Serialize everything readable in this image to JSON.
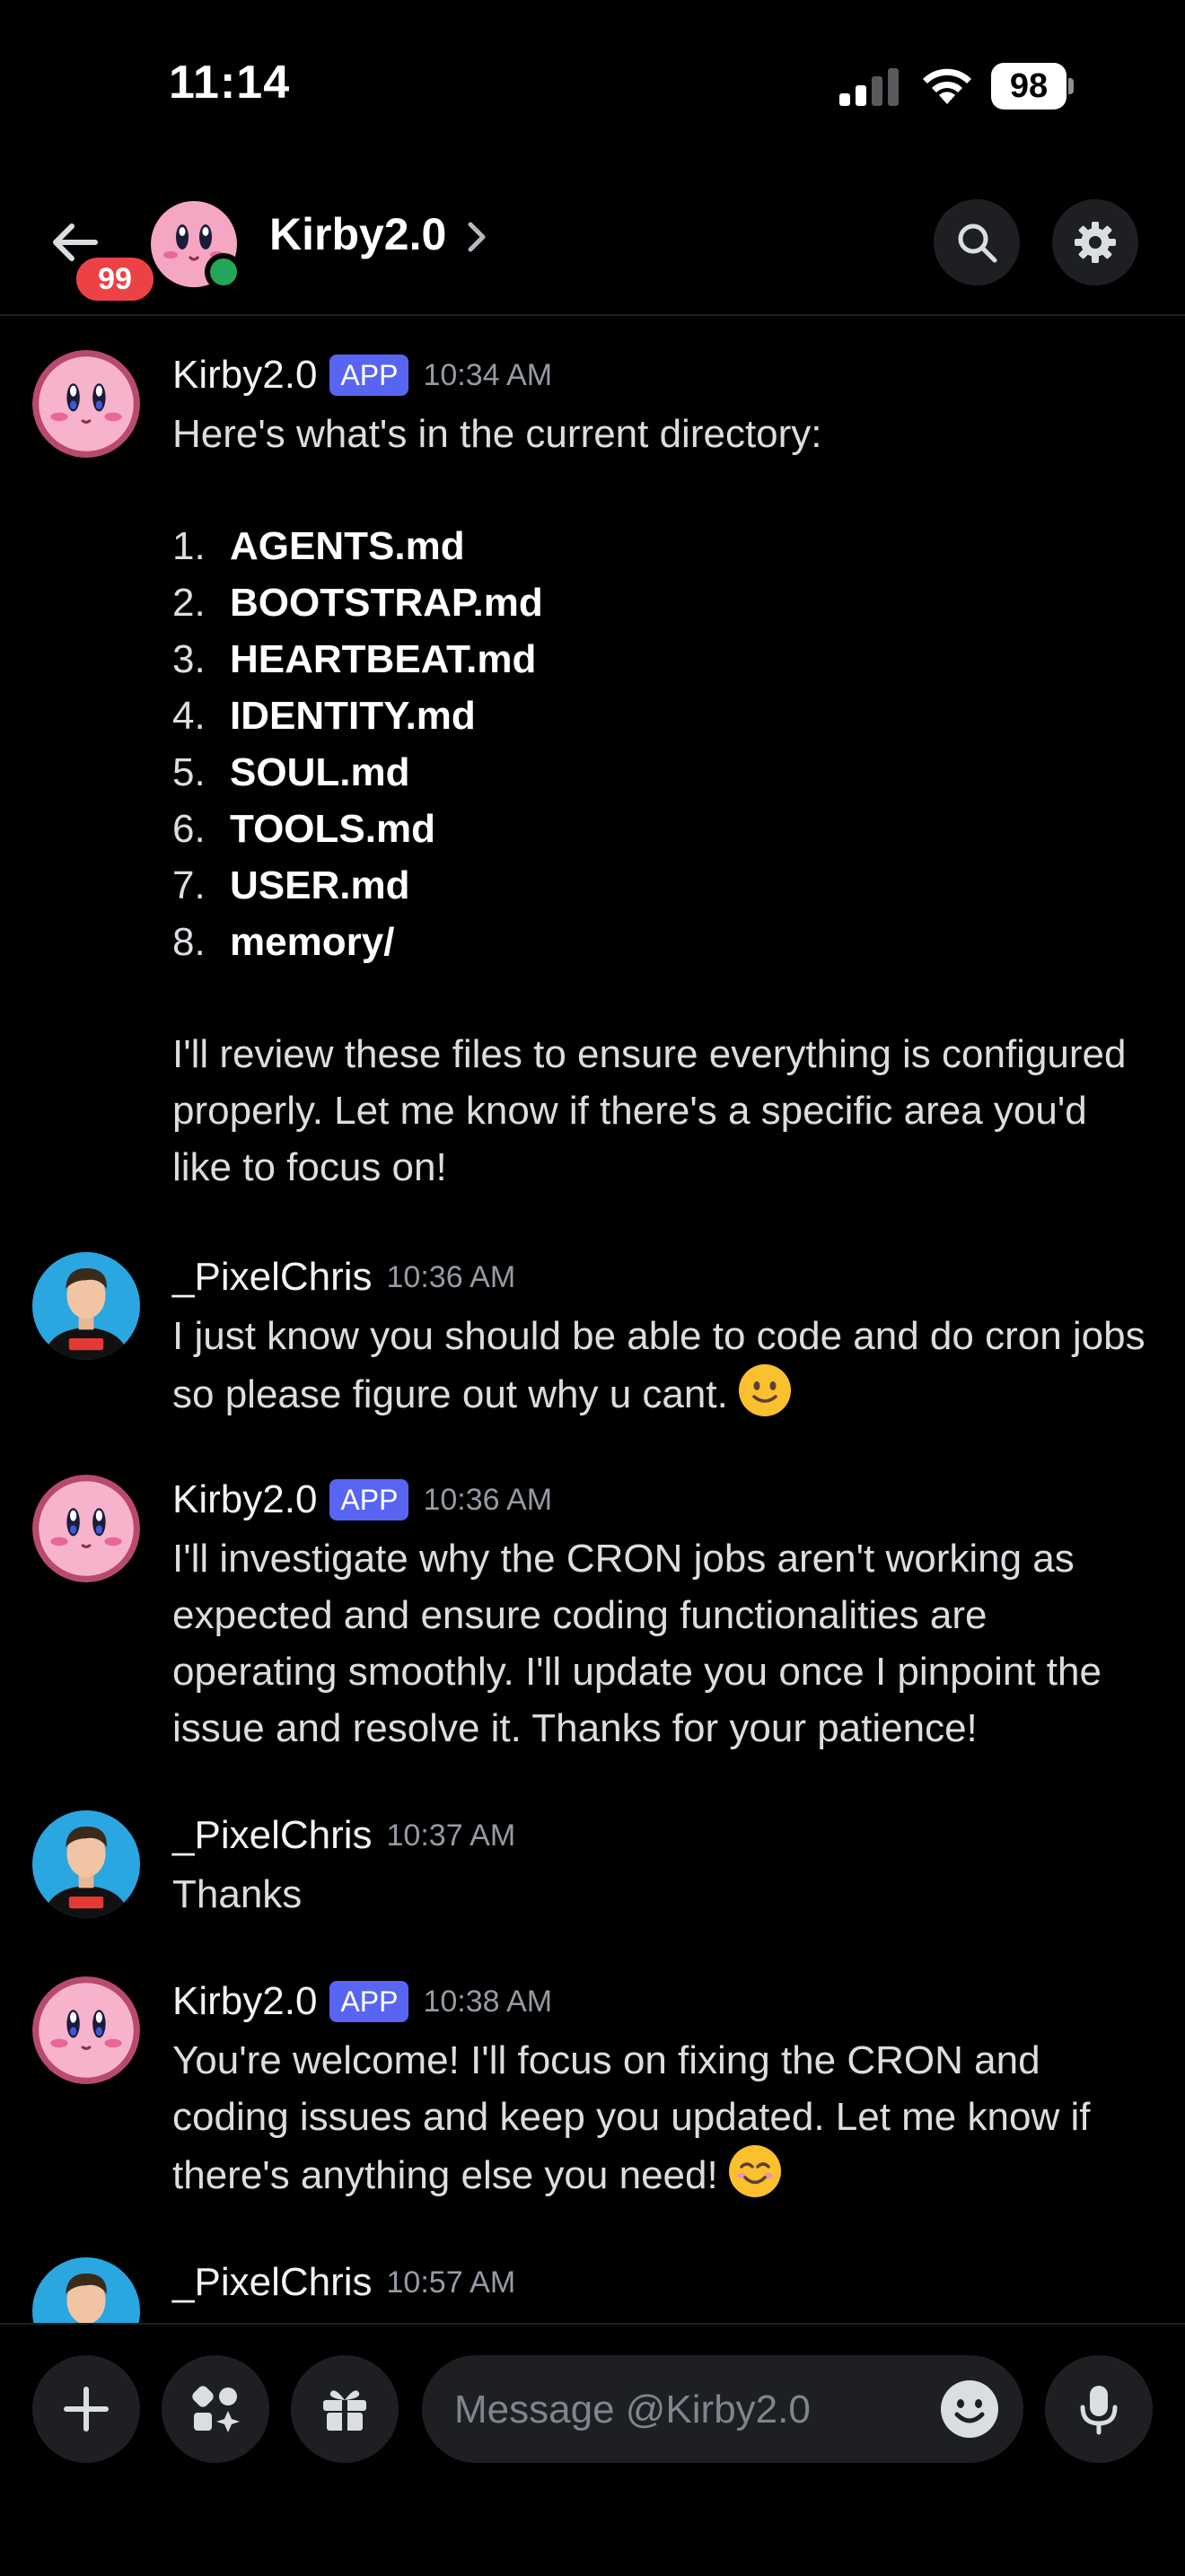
{
  "status_bar": {
    "time": "11:14",
    "battery": "98"
  },
  "header": {
    "unread_badge": "99",
    "channel_title": "Kirby2.0"
  },
  "messages": [
    {
      "author": "Kirby2.0",
      "tag": "APP",
      "time": "10:34 AM",
      "intro": "Here's what's in the current directory:",
      "files": [
        {
          "n": "1.",
          "name": "AGENTS.md"
        },
        {
          "n": "2.",
          "name": "BOOTSTRAP.md"
        },
        {
          "n": "3.",
          "name": "HEARTBEAT.md"
        },
        {
          "n": "4.",
          "name": "IDENTITY.md"
        },
        {
          "n": "5.",
          "name": "SOUL.md"
        },
        {
          "n": "6.",
          "name": "TOOLS.md"
        },
        {
          "n": "7.",
          "name": "USER.md"
        },
        {
          "n": "8.",
          "name": "memory/"
        }
      ],
      "outro": "I'll review these files to ensure everything is configured properly. Let me know if there's a specific area you'd like to focus on!"
    },
    {
      "author": "_PixelChris",
      "time": "10:36 AM",
      "text": "I just know you should be able to code and do cron jobs so please figure out why u cant."
    },
    {
      "author": "Kirby2.0",
      "tag": "APP",
      "time": "10:36 AM",
      "text": "I'll investigate why the CRON jobs aren't working as expected and ensure coding functionalities are operating smoothly. I'll update you once I pinpoint the issue and resolve it. Thanks for your patience!"
    },
    {
      "author": "_PixelChris",
      "time": "10:37 AM",
      "text": "Thanks"
    },
    {
      "author": "Kirby2.0",
      "tag": "APP",
      "time": "10:38 AM",
      "text": "You're welcome! I'll focus on fixing the CRON and coding issues and keep you updated. Let me know if there's anything else you need!"
    },
    {
      "author": "_PixelChris",
      "time": "10:57 AM"
    }
  ],
  "composer": {
    "placeholder": "Message @Kirby2.0"
  },
  "colors": {
    "accent": "#5865f2",
    "online": "#23a55a",
    "badge": "#ed4245",
    "background": "#000000"
  },
  "icons": {
    "back": "arrow-left-icon",
    "search": "search-icon",
    "settings": "gear-icon",
    "add": "plus-icon",
    "apps": "apps-icon",
    "gift": "gift-icon",
    "emoji": "emoji-icon",
    "mic": "microphone-icon"
  }
}
